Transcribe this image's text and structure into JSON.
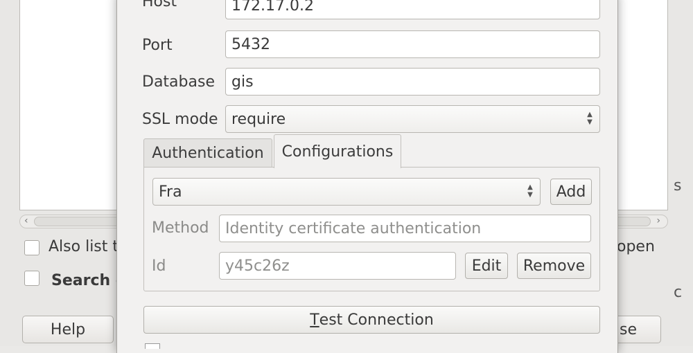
{
  "background": {
    "also_list_label": "Also list t",
    "search_label": "Search c",
    "open_label": "open",
    "help_button": "Help",
    "close_button_partial": "se",
    "right_edge_chars": [
      "s",
      "c"
    ]
  },
  "connection": {
    "host": {
      "label": "Host",
      "value": "172.17.0.2"
    },
    "port": {
      "label": "Port",
      "value": "5432"
    },
    "database": {
      "label": "Database",
      "value": "gis"
    },
    "ssl_mode": {
      "label": "SSL mode",
      "value": "require"
    }
  },
  "tabs": [
    {
      "label": "Authentication",
      "active": false
    },
    {
      "label": "Configurations",
      "active": true
    }
  ],
  "configurations": {
    "selected": "Fra",
    "add_button": "Add",
    "method_label": "Method",
    "method_value": "Identity certificate authentication",
    "id_label": "Id",
    "id_value": "y45c26z",
    "edit_button": "Edit",
    "remove_button": "Remove"
  },
  "test_connection": {
    "mnemonic": "T",
    "label_rest": "est Connection"
  }
}
